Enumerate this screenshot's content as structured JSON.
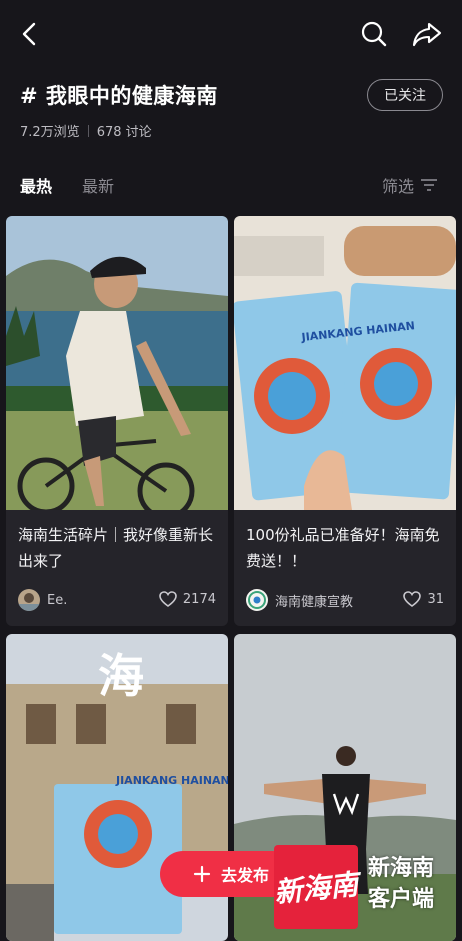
{
  "header": {
    "title": "# 我眼中的健康海南",
    "follow_label": "已关注",
    "views": "7.2万浏览",
    "discussions": "678 讨论"
  },
  "tabs": {
    "hot": "最热",
    "latest": "最新",
    "filter": "筛选"
  },
  "posts": [
    {
      "title": "海南生活碎片｜我好像重新长出来了",
      "author": "Ee.",
      "likes": "2174",
      "poster_text": ""
    },
    {
      "title": "100份礼品已准备好！海南免费送！！",
      "author": "海南健康宣教",
      "likes": "31",
      "poster_text": "JIANKANG HAINAN"
    },
    {
      "title": "",
      "author": "",
      "likes": "",
      "poster_text": "JIANKANG HAINAN"
    },
    {
      "title": "",
      "author": "",
      "likes": "",
      "poster_text": ""
    }
  ],
  "fab": {
    "publish_label": "去发布"
  },
  "watermark": {
    "logo_text": "新海南",
    "line1": "新海南",
    "line2": "客户端"
  },
  "colors": {
    "accent": "#f02f45",
    "background": "#17161b",
    "card": "#25242a"
  }
}
